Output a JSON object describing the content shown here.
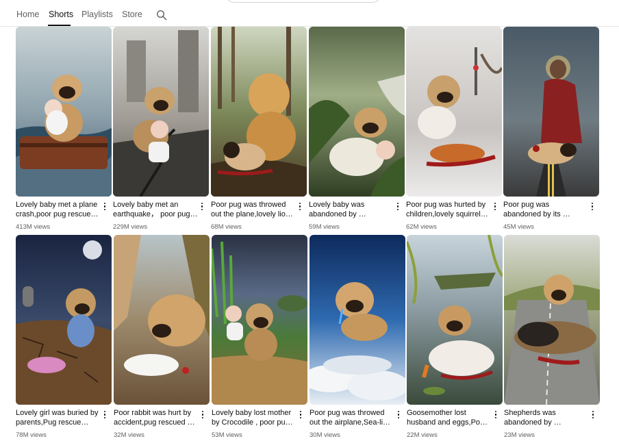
{
  "nav": {
    "tabs": [
      {
        "label": "Home",
        "active": false
      },
      {
        "label": "Shorts",
        "active": true
      },
      {
        "label": "Playlists",
        "active": false
      },
      {
        "label": "Store",
        "active": false
      }
    ],
    "search_icon": "search-icon"
  },
  "shorts": [
    {
      "title": "Lovely baby met a plane crash,poor pug rescue…",
      "views": "413M views"
    },
    {
      "title": "Lovely baby met an earthquake， poor pug…",
      "views": "229M views"
    },
    {
      "title": "Poor pug was throwed out the plane,lovely lio…",
      "views": "68M views"
    },
    {
      "title": "Lovely baby was abandoned by …",
      "views": "59M views"
    },
    {
      "title": "Poor pug was hurted by children,lovely squirrel…",
      "views": "62M views"
    },
    {
      "title": "Poor pug was abandoned by its …",
      "views": "45M views"
    },
    {
      "title": "Lovely girl was buried by parents,Pug rescue…",
      "views": "78M views"
    },
    {
      "title": "Poor rabbit was hurt by accident,pug rescued …",
      "views": "32M views"
    },
    {
      "title": "Lovely baby lost mother by Crocodile , poor pu…",
      "views": "53M views"
    },
    {
      "title": "Poor pug was throwed out the airplane,Sea-li…",
      "views": "30M views"
    },
    {
      "title": "Goosemother lost husband and eggs,Po…",
      "views": "22M views"
    },
    {
      "title": "Shepherds was abandoned by …",
      "views": "23M views"
    }
  ],
  "colors": {
    "text_primary": "#0f0f0f",
    "text_secondary": "#606060",
    "divider": "#e5e5e5"
  }
}
